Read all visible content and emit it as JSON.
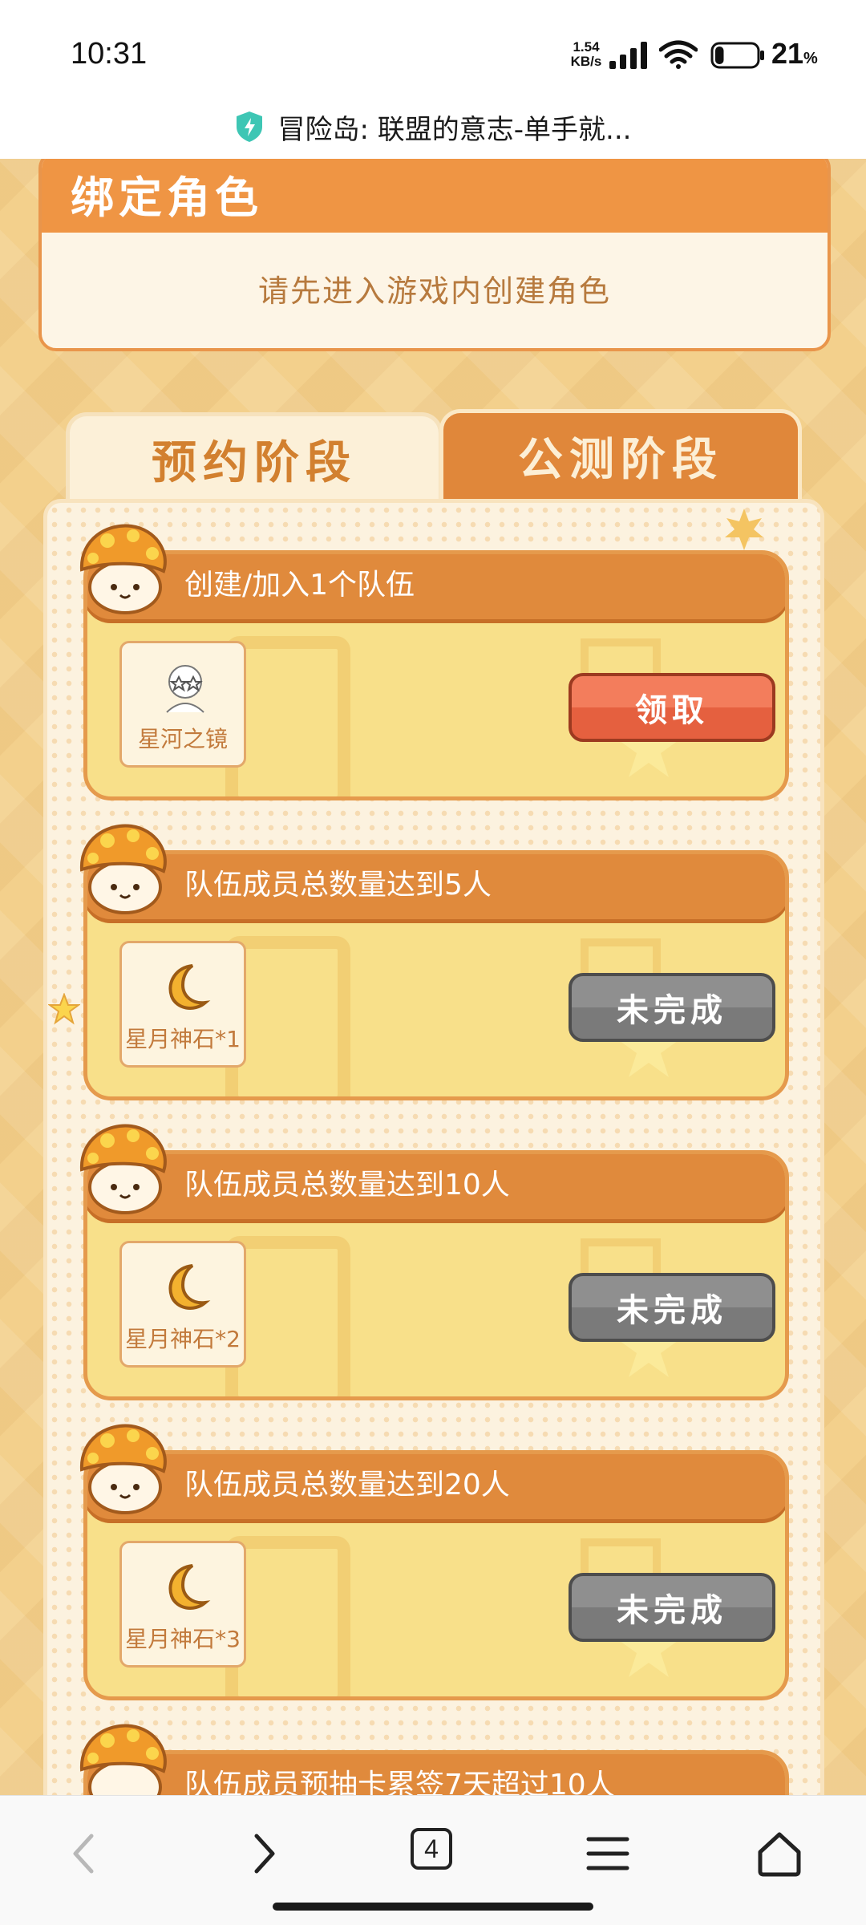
{
  "status_bar": {
    "time": "10:31",
    "net_speed_value": "1.54",
    "net_speed_unit": "KB/s",
    "battery_percent": "21",
    "battery_unit": "%",
    "battery_level": 0.21
  },
  "page": {
    "title": "冒险岛: 联盟的意志-单手就..."
  },
  "bind_role": {
    "title": "绑定角色",
    "hint": "请先进入游戏内创建角色"
  },
  "tabs": [
    {
      "label": "预约阶段",
      "active": true
    },
    {
      "label": "公测阶段",
      "active": false
    }
  ],
  "tasks": [
    {
      "title": "创建/加入1个队伍",
      "reward_label": "星河之镜",
      "reward_icon": "glasses-avatar-icon",
      "button_label": "领取",
      "state": "claimable"
    },
    {
      "title": "队伍成员总数量达到5人",
      "reward_label": "星月神石*1",
      "reward_icon": "moon-stone-icon",
      "button_label": "未完成",
      "state": "incomplete"
    },
    {
      "title": "队伍成员总数量达到10人",
      "reward_label": "星月神石*2",
      "reward_icon": "moon-stone-icon",
      "button_label": "未完成",
      "state": "incomplete"
    },
    {
      "title": "队伍成员总数量达到20人",
      "reward_label": "星月神石*3",
      "reward_icon": "moon-stone-icon",
      "button_label": "未完成",
      "state": "incomplete"
    },
    {
      "title": "队伍成员预抽卡累签7天超过10人"
    }
  ],
  "bottom_nav": {
    "tab_count": "4"
  },
  "colors": {
    "accent_orange": "#e08a3c",
    "claim_red": "#e5603f",
    "incomplete_gray": "#7a7a7a"
  }
}
